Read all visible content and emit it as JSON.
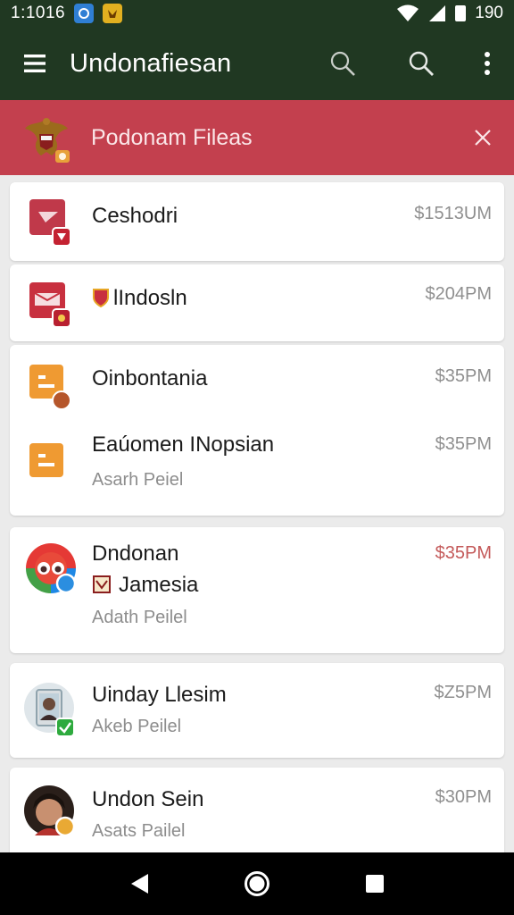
{
  "status_bar": {
    "time": "1:1016",
    "right_text": "190"
  },
  "app_bar": {
    "title": "Undonafiesan"
  },
  "banner": {
    "title": "Podonam Fileas"
  },
  "items": [
    {
      "name": "Ceshodri",
      "price": "$1513UM"
    },
    {
      "name": "lIndosln",
      "price": "$204PM"
    },
    {
      "name": "Oinbontania",
      "price": "$35PM"
    },
    {
      "name": "Eaúomen INopsian",
      "price": "$35PM",
      "sub": "Asarh Peiel"
    },
    {
      "name": "Dndonan",
      "name2": "Jamesia",
      "price": "$35PM",
      "sub": "Adath Peilel"
    },
    {
      "name": "Uinday Llesim",
      "price": "$Z5PM",
      "sub": "Akeb Peilel"
    },
    {
      "name": "Undon Sein",
      "price": "$30PM",
      "sub": "Asats Pailel"
    }
  ],
  "colors": {
    "app_bar": "#203822",
    "banner": "#c3404e",
    "price_accent": "#c45a5a"
  }
}
